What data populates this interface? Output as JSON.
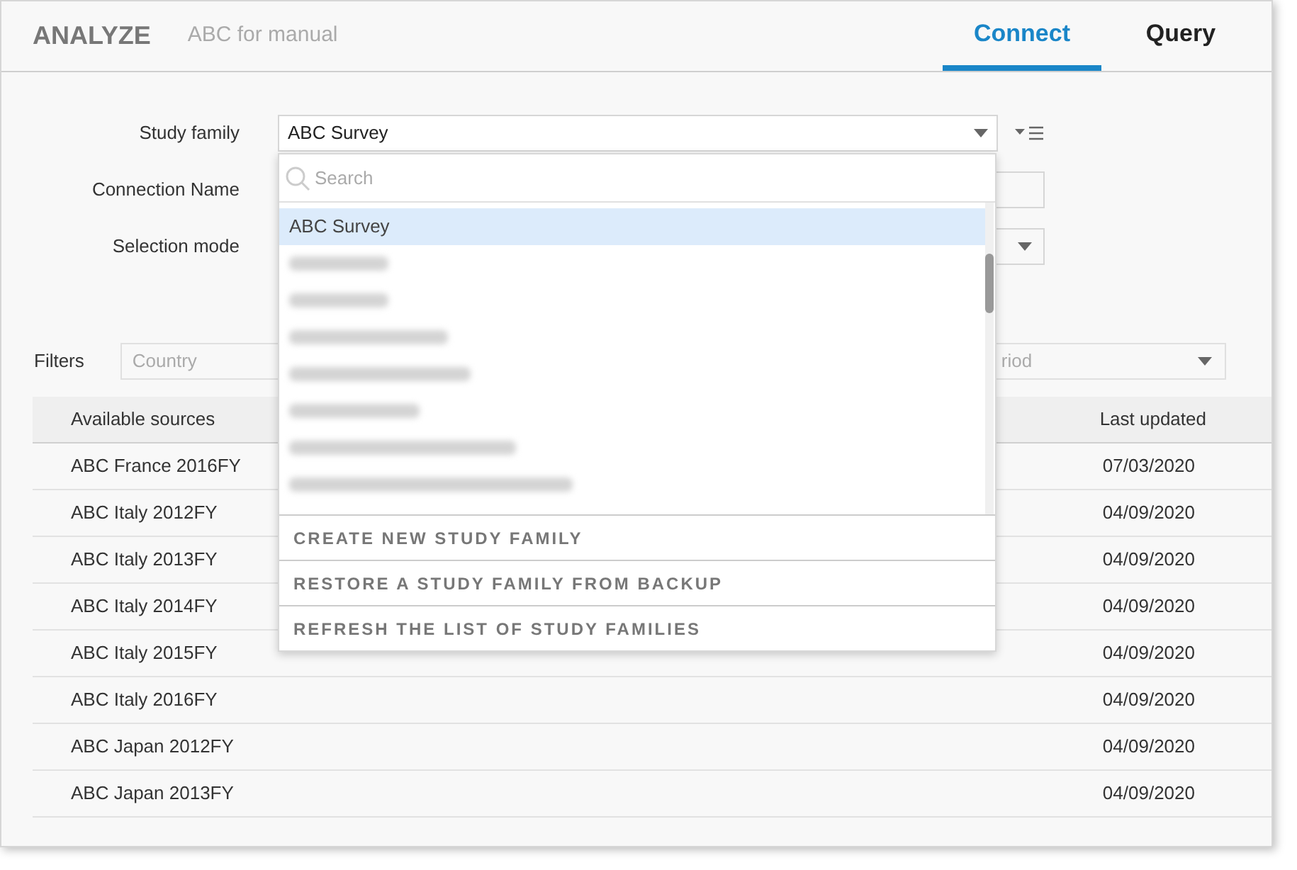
{
  "header": {
    "app_name": "ANALYZE",
    "project": "ABC for manual"
  },
  "tabs": [
    {
      "label": "Connect",
      "selected": true
    },
    {
      "label": "Query",
      "selected": false
    }
  ],
  "form": {
    "study_family": {
      "label": "Study family",
      "value": "ABC Survey"
    },
    "connection_name": {
      "label": "Connection Name"
    },
    "selection_mode": {
      "label": "Selection mode"
    }
  },
  "dropdown": {
    "search_placeholder": "Search",
    "items": [
      {
        "kind": "text",
        "label": "ABC Survey",
        "selected": true
      },
      {
        "kind": "blurred",
        "selected": false
      },
      {
        "kind": "blurred",
        "selected": false
      },
      {
        "kind": "blurred",
        "selected": false
      },
      {
        "kind": "blurred",
        "selected": false
      },
      {
        "kind": "blurred",
        "selected": false
      },
      {
        "kind": "blurred",
        "selected": false
      },
      {
        "kind": "blurred",
        "selected": false
      }
    ],
    "actions": [
      "CREATE NEW STUDY FAMILY",
      "RESTORE A STUDY FAMILY FROM BACKUP",
      "REFRESH THE LIST OF STUDY FAMILIES"
    ]
  },
  "filters": {
    "label": "Filters",
    "country_placeholder": "Country",
    "period_placeholder": "riod"
  },
  "table": {
    "columns": [
      "Available sources",
      "Last updated"
    ],
    "rows": [
      [
        "ABC France 2016FY",
        "07/03/2020"
      ],
      [
        "ABC Italy 2012FY",
        "04/09/2020"
      ],
      [
        "ABC Italy 2013FY",
        "04/09/2020"
      ],
      [
        "ABC Italy 2014FY",
        "04/09/2020"
      ],
      [
        "ABC Italy 2015FY",
        "04/09/2020"
      ],
      [
        "ABC Italy 2016FY",
        "04/09/2020"
      ],
      [
        "ABC Japan 2012FY",
        "04/09/2020"
      ],
      [
        "ABC Japan 2013FY",
        "04/09/2020"
      ]
    ]
  }
}
